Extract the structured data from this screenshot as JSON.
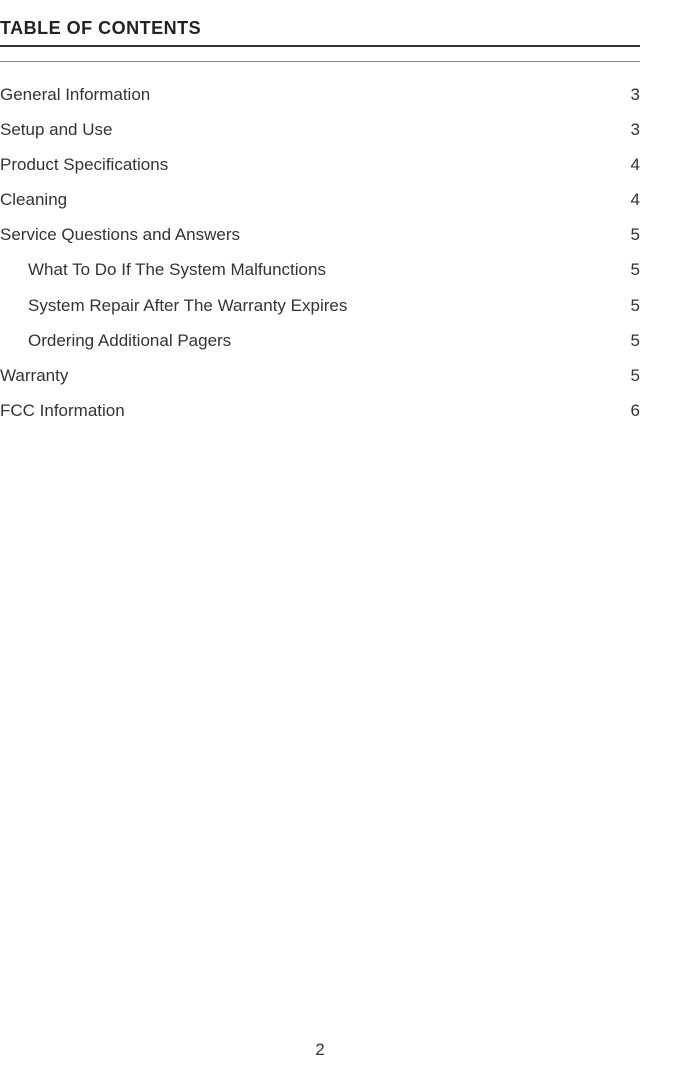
{
  "heading": "TABLE OF CONTENTS",
  "toc": [
    {
      "label": "General Information",
      "page": "3",
      "indent": false
    },
    {
      "label": "Setup and Use",
      "page": "3",
      "indent": false
    },
    {
      "label": "Product Specifications",
      "page": "4",
      "indent": false
    },
    {
      "label": "Cleaning",
      "page": "4",
      "indent": false
    },
    {
      "label": "Service Questions and Answers",
      "page": "5",
      "indent": false
    },
    {
      "label": "What To Do If The System Malfunctions",
      "page": "5",
      "indent": true
    },
    {
      "label": "System Repair After The Warranty Expires",
      "page": "5",
      "indent": true
    },
    {
      "label": "Ordering Additional Pagers",
      "page": "5",
      "indent": true
    },
    {
      "label": "Warranty",
      "page": "5",
      "indent": false
    },
    {
      "label": "FCC Information",
      "page": "6",
      "indent": false
    }
  ],
  "pageNumber": "2"
}
